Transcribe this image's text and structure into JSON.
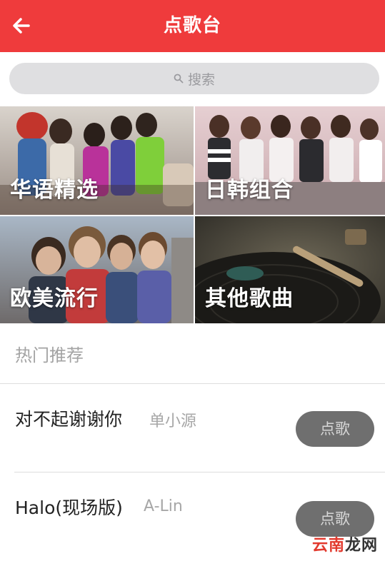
{
  "header": {
    "title": "点歌台",
    "bg_color": "#ef3b3c"
  },
  "search": {
    "placeholder": "搜索"
  },
  "categories": [
    {
      "label": "华语精选"
    },
    {
      "label": "日韩组合"
    },
    {
      "label": "欧美流行"
    },
    {
      "label": "其他歌曲"
    }
  ],
  "section": {
    "title": "热门推荐"
  },
  "songs": [
    {
      "title": "对不起谢谢你",
      "artist": "单小源",
      "button": "点歌"
    },
    {
      "title": "Halo(现场版)",
      "artist": "A-Lin",
      "button": "点歌"
    }
  ],
  "watermark": {
    "part1": "云南",
    "part2": "龙网"
  },
  "icons": {
    "back": "back-arrow-icon",
    "search": "search-icon"
  }
}
